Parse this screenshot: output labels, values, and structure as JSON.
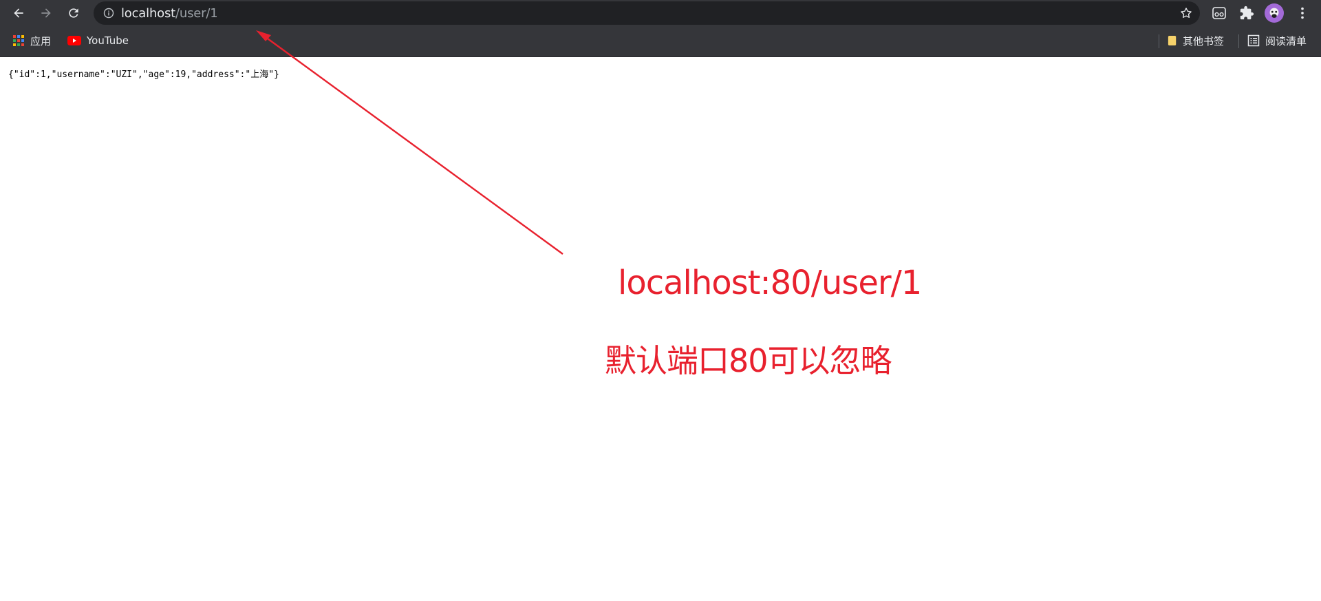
{
  "browser": {
    "url_host": "localhost",
    "url_path": "/user/1",
    "bookmarks": [
      {
        "label": "应用",
        "icon": "apps-grid-icon"
      },
      {
        "label": "YouTube",
        "icon": "youtube-icon"
      }
    ],
    "other_bookmarks_label": "其他书签",
    "reading_list_label": "阅读清单"
  },
  "page": {
    "json_text": "{\"id\":1,\"username\":\"UZI\",\"age\":19,\"address\":\"上海\"}"
  },
  "annotation": {
    "line1": "localhost:80/user/1",
    "line2": "默认端口80可以忽略",
    "color": "#e8212e"
  },
  "colors": {
    "toolbar_bg": "#35363a",
    "omnibox_bg": "#202124",
    "avatar_bg": "#a36ad8"
  }
}
